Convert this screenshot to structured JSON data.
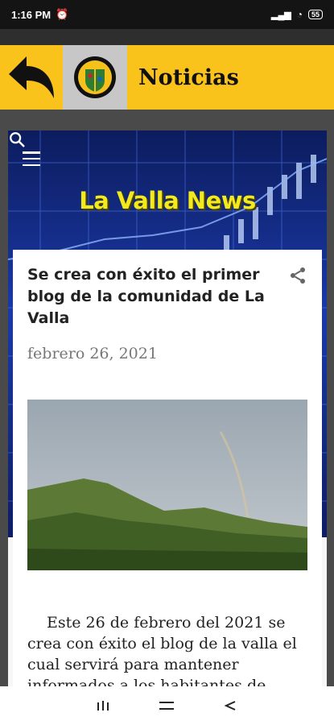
{
  "status_bar": {
    "time": "1:16 PM",
    "battery": "55"
  },
  "header": {
    "title": "Noticias"
  },
  "blog": {
    "name": "La Valla News"
  },
  "post": {
    "title": "Se crea con éxito el primer blog de la comunidad de La Valla",
    "date": "febrero 26, 2021",
    "body": "Este 26 de febrero del 2021 se crea con éxito el blog de la valla el cual servirá para mantener informados a los habitantes de"
  },
  "colors": {
    "header_bg": "#f9c31b",
    "blog_title": "#f2ea1c",
    "hero_bg": "#1b3aa8"
  },
  "icons": [
    "back-arrow-icon",
    "logo-icon",
    "menu-icon",
    "search-icon",
    "share-icon",
    "recents-icon",
    "home-icon",
    "back-icon"
  ]
}
